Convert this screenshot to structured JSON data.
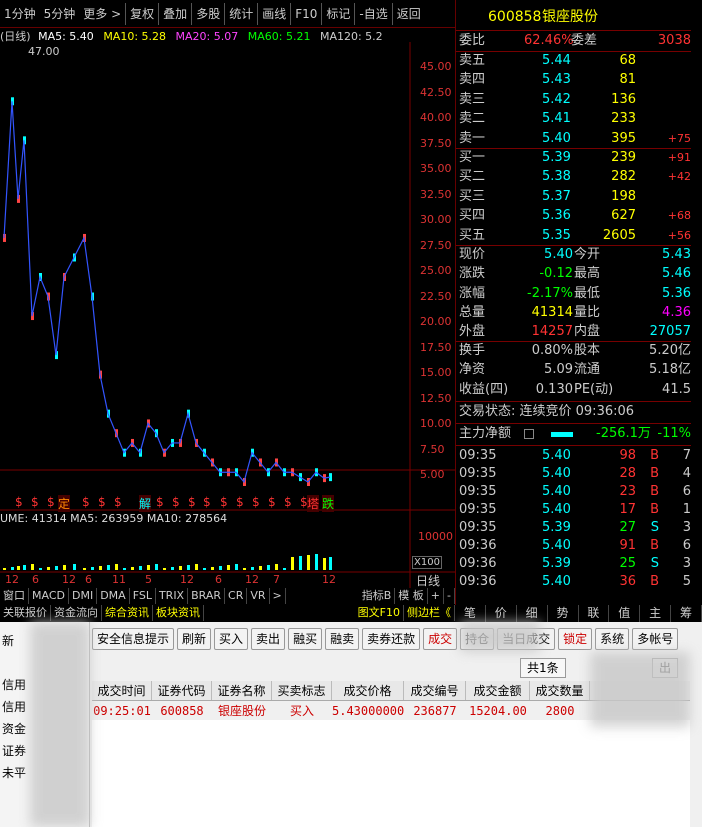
{
  "toolbar": {
    "items": [
      "(日线)",
      "1分钟",
      "5分钟",
      "更多 >",
      "复权",
      "叠加",
      "多股",
      "统计",
      "画线",
      "F10",
      "标记",
      "-自选",
      "返回"
    ]
  },
  "ma_line": {
    "label_main": "(日线)",
    "ma5": "MA5: 5.40",
    "ma10": "MA10: 5.28",
    "ma20": "MA20: 5.07",
    "ma60": "MA60: 5.21",
    "ma120": "MA120: 5.2"
  },
  "chart_high_label": "47.00",
  "price_axis": [
    "45.00",
    "42.50",
    "40.00",
    "37.50",
    "35.00",
    "32.50",
    "30.00",
    "27.50",
    "25.00",
    "22.50",
    "20.00",
    "17.50",
    "15.00",
    "12.50",
    "10.00",
    "7.50",
    "5.00"
  ],
  "markers": [
    "$",
    "$",
    "$",
    "定",
    "$",
    "$",
    "$",
    "解",
    "$",
    "$",
    "$",
    "$",
    "$",
    "$",
    "$",
    "$",
    "$",
    "$",
    "塔",
    "跌"
  ],
  "volume_line": "UME: 41314  MA5: 263959  MA10: 278564",
  "volume_axis": [
    "10000",
    "X100"
  ],
  "date_axis": [
    "12",
    "6",
    "12",
    "6",
    "11",
    "5",
    "12",
    "6",
    "12",
    "7",
    "12"
  ],
  "date_axis_label": "日线",
  "indicator_tabs": [
    "窗口",
    "MACD",
    "DMI",
    "DMA",
    "FSL",
    "TRIX",
    "BRAR",
    "CR",
    "VR",
    ">",
    "指标B",
    "模 板",
    "+",
    "-"
  ],
  "bottom_tabs": [
    "关联报价",
    "资金流向",
    "综合资讯",
    "板块资讯",
    "图文F10",
    "侧边栏《"
  ],
  "quote": {
    "code": "600858",
    "name": "银座股份",
    "weibi_label": "委比",
    "weibi_value": "62.46%",
    "weicha_label": "委差",
    "weicha_value": "3038",
    "asks": [
      {
        "label": "卖五",
        "price": "5.44",
        "vol": "68",
        "chg": ""
      },
      {
        "label": "卖四",
        "price": "5.43",
        "vol": "81",
        "chg": ""
      },
      {
        "label": "卖三",
        "price": "5.42",
        "vol": "136",
        "chg": ""
      },
      {
        "label": "卖二",
        "price": "5.41",
        "vol": "233",
        "chg": ""
      },
      {
        "label": "卖一",
        "price": "5.40",
        "vol": "395",
        "chg": "+75"
      }
    ],
    "bids": [
      {
        "label": "买一",
        "price": "5.39",
        "vol": "239",
        "chg": "+91"
      },
      {
        "label": "买二",
        "price": "5.38",
        "vol": "282",
        "chg": "+42"
      },
      {
        "label": "买三",
        "price": "5.37",
        "vol": "198",
        "chg": ""
      },
      {
        "label": "买四",
        "price": "5.36",
        "vol": "627",
        "chg": "+68"
      },
      {
        "label": "买五",
        "price": "5.35",
        "vol": "2605",
        "chg": "+56"
      }
    ],
    "stats": [
      {
        "l1": "现价",
        "v1": "5.40",
        "l2": "今开",
        "v2": "5.43"
      },
      {
        "l1": "涨跌",
        "v1": "-0.12",
        "l2": "最高",
        "v2": "5.46"
      },
      {
        "l1": "涨幅",
        "v1": "-2.17%",
        "l2": "最低",
        "v2": "5.36"
      },
      {
        "l1": "总量",
        "v1": "41314",
        "l2": "量比",
        "v2": "4.36"
      },
      {
        "l1": "外盘",
        "v1": "14257",
        "l2": "内盘",
        "v2": "27057"
      }
    ],
    "stats2": [
      {
        "l1": "换手",
        "v1": "0.80%",
        "l2": "股本",
        "v2": "5.20亿"
      },
      {
        "l1": "净资",
        "v1": "5.09",
        "l2": "流通",
        "v2": "5.18亿"
      },
      {
        "l1": "收益(四)",
        "v1": "0.130",
        "l2": "PE(动)",
        "v2": "41.5"
      }
    ],
    "trade_status": "交易状态: 连续竞价 09:36:06",
    "main_flow_label": "主力净额",
    "main_flow_value": "-256.1万",
    "main_flow_pct": "-11%",
    "ticks": [
      {
        "time": "09:35",
        "price": "5.40",
        "vol": "98",
        "side": "B",
        "n": "7"
      },
      {
        "time": "09:35",
        "price": "5.40",
        "vol": "28",
        "side": "B",
        "n": "4"
      },
      {
        "time": "09:35",
        "price": "5.40",
        "vol": "23",
        "side": "B",
        "n": "6"
      },
      {
        "time": "09:35",
        "price": "5.40",
        "vol": "17",
        "side": "B",
        "n": "1"
      },
      {
        "time": "09:35",
        "price": "5.39",
        "vol": "27",
        "side": "S",
        "n": "3"
      },
      {
        "time": "09:36",
        "price": "5.40",
        "vol": "91",
        "side": "B",
        "n": "6"
      },
      {
        "time": "09:36",
        "price": "5.39",
        "vol": "25",
        "side": "S",
        "n": "3"
      },
      {
        "time": "09:36",
        "price": "5.40",
        "vol": "36",
        "side": "B",
        "n": "5"
      }
    ]
  },
  "right_tabs": [
    "笔",
    "价",
    "细",
    "势",
    "联",
    "值",
    "主",
    "筹"
  ],
  "trade": {
    "left_items": [
      "新",
      "",
      "信用",
      "信用",
      "资金",
      "证券",
      "未平"
    ],
    "buttons": [
      "安全信息提示",
      "刷新",
      "买入",
      "卖出",
      "融买",
      "融卖",
      "卖券还款",
      "成交",
      "持仓",
      "当日成交",
      "锁定",
      "系统",
      "多帐号"
    ],
    "count_label": "共1条",
    "out_label": "出",
    "columns": [
      "成交时间",
      "证券代码",
      "证券名称",
      "买卖标志",
      "成交价格",
      "成交编号",
      "成交金额",
      "成交数量"
    ],
    "row": [
      "09:25:01",
      "600858",
      "银座股份",
      "买入",
      "5.43000000",
      "236877",
      "15204.00",
      "2800"
    ]
  },
  "colors": {
    "red": "#ff3333",
    "green": "#00e000",
    "yellow": "#ffff00",
    "cyan": "#00ffff",
    "ma5": "#ffffff",
    "ma10": "#ffff00",
    "ma20": "#ff44ff",
    "ma60": "#00ff00"
  }
}
